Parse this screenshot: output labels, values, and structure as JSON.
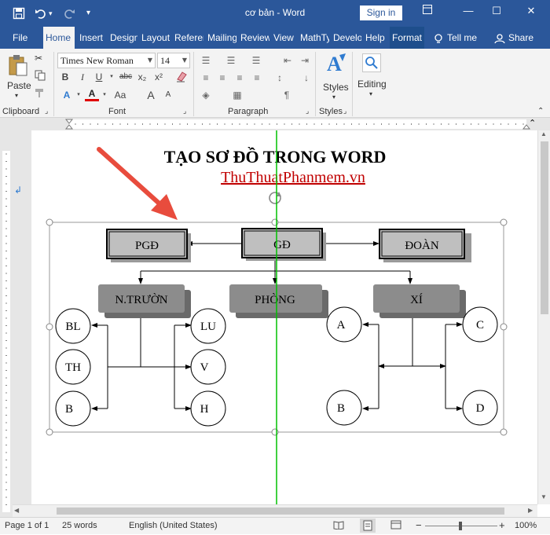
{
  "window": {
    "title": "cơ bản  -  Word",
    "sign_in": "Sign in",
    "quick_access": [
      "save-icon",
      "undo-icon",
      "redo-icon",
      "customize-icon"
    ],
    "controls": [
      "ribbon-display-icon",
      "minimize-icon",
      "maximize-icon",
      "close-icon"
    ]
  },
  "tabs": [
    {
      "label": "File"
    },
    {
      "label": "Home"
    },
    {
      "label": "Insert"
    },
    {
      "label": "Design"
    },
    {
      "label": "Layout"
    },
    {
      "label": "References"
    },
    {
      "label": "Mailings"
    },
    {
      "label": "Review"
    },
    {
      "label": "View"
    },
    {
      "label": "MathType"
    },
    {
      "label": "Developer"
    },
    {
      "label": "Help"
    },
    {
      "label": "Format"
    }
  ],
  "tell_me": "Tell me",
  "share": "Share",
  "ribbon": {
    "clipboard": {
      "paste": "Paste",
      "label": "Clipboard"
    },
    "font": {
      "family": "Times New Roman",
      "size": "14",
      "bold": "B",
      "italic": "I",
      "underline": "U",
      "strike": "abc",
      "subscript": "x₂",
      "superscript": "x²",
      "label": "Font"
    },
    "paragraph": {
      "label": "Paragraph"
    },
    "styles": {
      "button": "Styles",
      "label": "Styles"
    },
    "editing": {
      "button": "Editing"
    }
  },
  "document": {
    "heading": "TẠO SƠ ĐỒ TRONG WORD",
    "subheading": "ThuThuatPhanmem.vn",
    "diagram": {
      "top_boxes": [
        "PGĐ",
        "GĐ",
        "ĐOÀN"
      ],
      "mid_boxes": [
        "N.TRƯỜN",
        "PHÒNG",
        "XÍ"
      ],
      "left_circles": [
        "BL",
        "TH",
        "B"
      ],
      "middle_circles": [
        "LU",
        "V",
        "H"
      ],
      "right_left_circles": [
        "A",
        "B"
      ],
      "right_right_circles": [
        "C",
        "D"
      ]
    }
  },
  "status": {
    "page": "Page 1 of 1",
    "words": "25 words",
    "language": "English (United States)",
    "zoom": "100%"
  },
  "colors": {
    "title_bar": "#2b579a",
    "ribbon": "#f3f3f3",
    "subheading": "#c00000",
    "arrow": "#e84c3d",
    "guide_line": "#00c000"
  }
}
